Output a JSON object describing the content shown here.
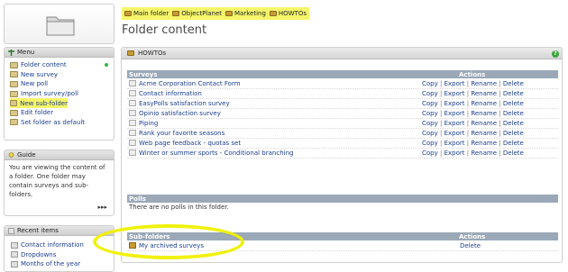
{
  "breadcrumbs": [
    "Main folder",
    "ObjectPlanet",
    "Marketing",
    "HOWTOs"
  ],
  "page_title": "Folder content",
  "sidebar": {
    "menu_title": "Menu",
    "menu_items": [
      "Folder content",
      "New survey",
      "New poll",
      "Import survey/poll",
      "New sub-folder",
      "Edit folder",
      "Set folder as default"
    ],
    "guide_title": "Guide",
    "guide_text": "You are viewing the content of a folder. One folder may contain surveys and sub-folders.",
    "guide_more": "▸▸▸",
    "recent_title": "Recent items",
    "recent_items": [
      "Contact information",
      "Dropdowns",
      "Months of the year"
    ]
  },
  "panel": {
    "title": "HOWTOs",
    "surveys_header": "Surveys",
    "actions_header": "Actions",
    "surveys": [
      "Acme Corporation Contact Form",
      "Contact information",
      "EasyPolls satisfaction survey",
      "Opinio satisfaction survey",
      "Piping",
      "Rank your favorite seasons",
      "Web page feedback - quotas set",
      "Winter or summer sports - Conditional branching"
    ],
    "action_links": [
      "Copy",
      "Export",
      "Rename",
      "Delete"
    ],
    "polls_header": "Polls",
    "polls_empty": "There are no polls in this folder.",
    "subfolders_header": "Sub-folders",
    "subfolders": [
      "My archived surveys"
    ],
    "subfolder_action": "Delete"
  },
  "colors": {
    "highlight": "#f5f56a",
    "section_header": "#9aa8b8",
    "link": "#1c3f8f"
  }
}
